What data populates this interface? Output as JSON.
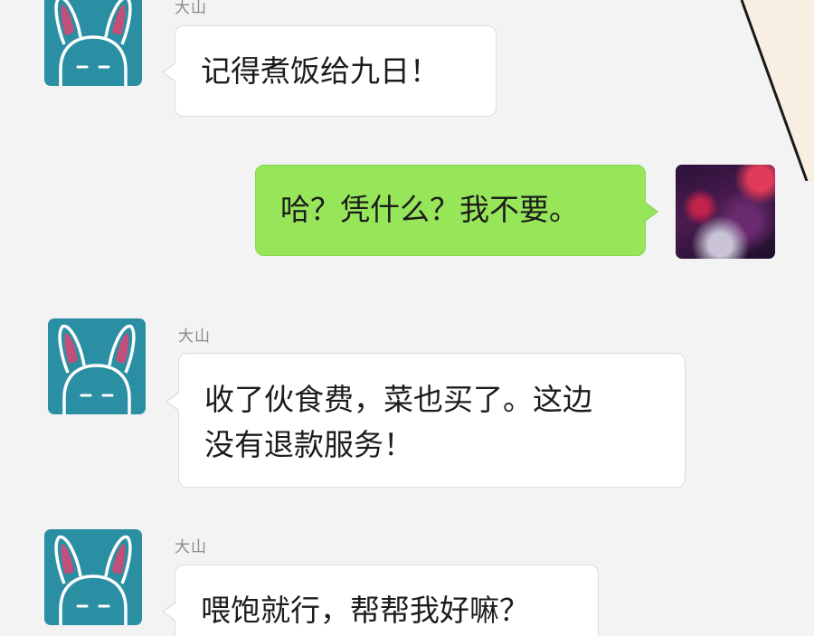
{
  "messages": [
    {
      "side": "other",
      "sender": "大山",
      "text": "记得煮饭给九日！"
    },
    {
      "side": "self",
      "text": "哈？凭什么？我不要。"
    },
    {
      "side": "other",
      "sender": "大山",
      "text_lines": [
        "收了伙食费，菜也买了。这边",
        "没有退款服务！"
      ]
    },
    {
      "side": "other",
      "sender": "大山",
      "text": "喂饱就行，帮帮我好嘛？"
    }
  ],
  "icons": {
    "contact_avatar": "rabbit-icon",
    "self_avatar": "nebula-photo"
  },
  "colors": {
    "background": "#f3f3f3",
    "self_bubble": "#97e65a",
    "other_bubble": "#ffffff",
    "avatar_bg": "#2b8fa3",
    "sender_name": "#8a8a8a"
  }
}
